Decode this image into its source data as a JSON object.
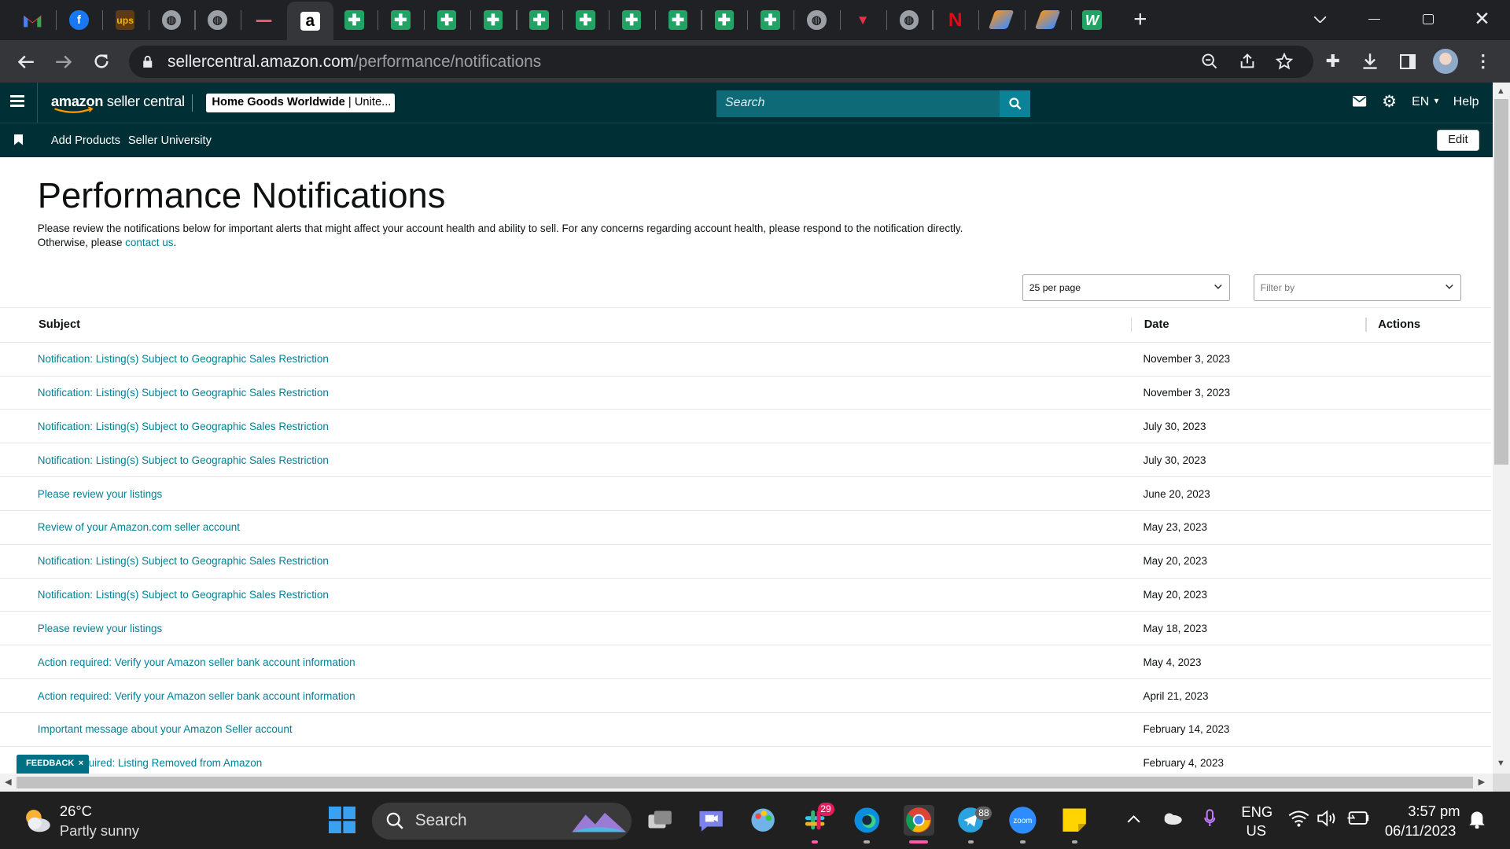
{
  "browser": {
    "url_host": "sellercentral.amazon.com",
    "url_path": "/performance/notifications",
    "tab_icons": [
      "gmail-icon",
      "facebook-icon",
      "ups-icon",
      "globe-icon",
      "globe-icon",
      "site-icon",
      "amazon-icon",
      "sheets-icon",
      "sheets-icon",
      "sheets-icon",
      "sheets-icon",
      "sheets-icon",
      "sheets-icon",
      "sheets-icon",
      "sheets-icon",
      "sheets-icon",
      "sheets-icon",
      "globe-icon",
      "site-icon",
      "globe-icon",
      "netflix-icon",
      "app-icon",
      "app-icon",
      "w-icon"
    ]
  },
  "header": {
    "logo_amazon": "amazon",
    "logo_rest": " seller central",
    "store_name": "Home Goods Worldwide",
    "store_region": " | Unite...",
    "search_placeholder": "Search",
    "language": "EN",
    "help": "Help"
  },
  "subnav": {
    "links": [
      "Add Products",
      "Seller University"
    ],
    "edit": "Edit"
  },
  "page": {
    "title": "Performance Notifications",
    "intro_text": "Please review the notifications below for important alerts that might affect your account health and ability to sell. For any concerns regarding account health, please respond to the notification directly. Otherwise, please ",
    "intro_link": "contact us",
    "intro_end": ".",
    "per_page": "25 per page",
    "filter_placeholder": "Filter by",
    "feedback": "FEEDBACK"
  },
  "table": {
    "headers": {
      "subject": "Subject",
      "date": "Date",
      "actions": "Actions"
    },
    "rows": [
      {
        "subject": "Notification: Listing(s) Subject to Geographic Sales Restriction",
        "date": "November 3, 2023"
      },
      {
        "subject": "Notification: Listing(s) Subject to Geographic Sales Restriction",
        "date": "November 3, 2023"
      },
      {
        "subject": "Notification: Listing(s) Subject to Geographic Sales Restriction",
        "date": "July 30, 2023"
      },
      {
        "subject": "Notification: Listing(s) Subject to Geographic Sales Restriction",
        "date": "July 30, 2023"
      },
      {
        "subject": "Please review your listings",
        "date": "June 20, 2023"
      },
      {
        "subject": "Review of your Amazon.com seller account",
        "date": "May 23, 2023"
      },
      {
        "subject": "Notification: Listing(s) Subject to Geographic Sales Restriction",
        "date": "May 20, 2023"
      },
      {
        "subject": "Notification: Listing(s) Subject to Geographic Sales Restriction",
        "date": "May 20, 2023"
      },
      {
        "subject": "Please review your listings",
        "date": "May 18, 2023"
      },
      {
        "subject": "Action required: Verify your Amazon seller bank account information",
        "date": "May 4, 2023"
      },
      {
        "subject": "Action required: Verify your Amazon seller bank account information",
        "date": "April 21, 2023"
      },
      {
        "subject": "Important message about your Amazon Seller account",
        "date": "February 14, 2023"
      },
      {
        "subject": "uired: Listing Removed from Amazon",
        "date": "February 4, 2023"
      }
    ]
  },
  "taskbar": {
    "temp": "26°C",
    "weather": "Partly sunny",
    "search": "Search",
    "slack_badge": "29",
    "telegram_badge": "88",
    "lang1": "ENG",
    "lang2": "US",
    "time": "3:57 pm",
    "date": "06/11/2023"
  }
}
